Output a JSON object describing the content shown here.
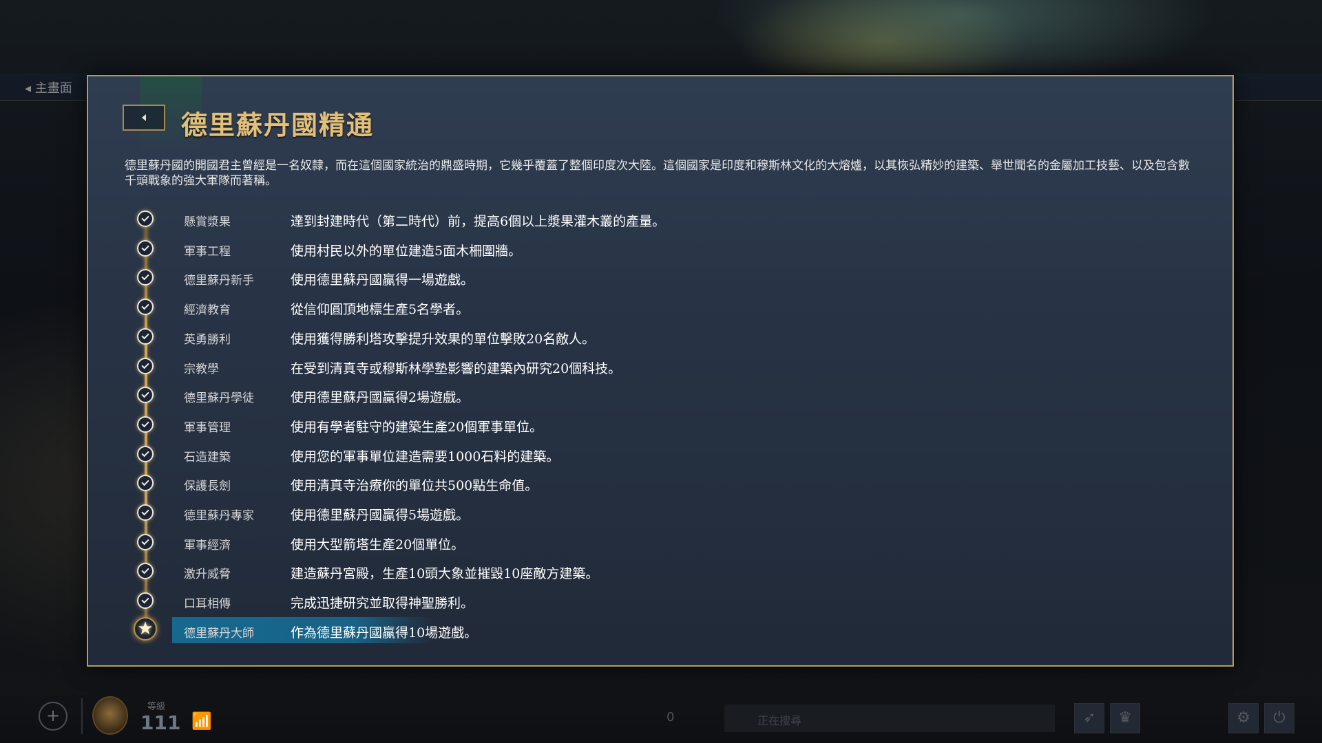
{
  "background": {
    "back_label": "◂ 主畫面"
  },
  "dialog": {
    "title": "德里蘇丹國精通",
    "description": "德里蘇丹國的開國君主曾經是一名奴隸，而在這個國家統治的鼎盛時期，它幾乎覆蓋了整個印度次大陸。這個國家是印度和穆斯林文化的大熔爐，以其恢弘精妙的建築、舉世聞名的金屬加工技藝、以及包含數千頭戰象的強大軍隊而著稱。",
    "back_icon": "chevron-left-icon",
    "accent_color": "#e3c07a",
    "highlight_color": "#166c94"
  },
  "masteries": [
    {
      "name": "懸賞漿果",
      "description": "達到封建時代（第二時代）前，提高6個以上漿果灌木叢的產量。",
      "status": "completed"
    },
    {
      "name": "軍事工程",
      "description": "使用村民以外的單位建造5面木柵圍牆。",
      "status": "completed"
    },
    {
      "name": "德里蘇丹新手",
      "description": "使用德里蘇丹國贏得一場遊戲。",
      "status": "completed"
    },
    {
      "name": "經濟教育",
      "description": "從信仰圓頂地標生產5名學者。",
      "status": "completed"
    },
    {
      "name": "英勇勝利",
      "description": "使用獲得勝利塔攻擊提升效果的單位擊敗20名敵人。",
      "status": "completed"
    },
    {
      "name": "宗教學",
      "description": "在受到清真寺或穆斯林學塾影響的建築內研究20個科技。",
      "status": "completed"
    },
    {
      "name": "德里蘇丹學徒",
      "description": "使用德里蘇丹國贏得2場遊戲。",
      "status": "completed"
    },
    {
      "name": "軍事管理",
      "description": "使用有學者駐守的建築生產20個軍事單位。",
      "status": "completed"
    },
    {
      "name": "石造建築",
      "description": "使用您的軍事單位建造需要1000石料的建築。",
      "status": "completed"
    },
    {
      "name": "保護長劍",
      "description": "使用清真寺治療你的單位共500點生命值。",
      "status": "completed"
    },
    {
      "name": "德里蘇丹專家",
      "description": "使用德里蘇丹國贏得5場遊戲。",
      "status": "completed"
    },
    {
      "name": "軍事經濟",
      "description": "使用大型箭塔生產20個單位。",
      "status": "completed"
    },
    {
      "name": "激升威脅",
      "description": "建造蘇丹宮殿，生產10頭大象並摧毀10座敵方建築。",
      "status": "completed"
    },
    {
      "name": "口耳相傳",
      "description": "完成迅捷研究並取得神聖勝利。",
      "status": "completed"
    },
    {
      "name": "德里蘇丹大師",
      "description": "作為德里蘇丹國贏得10場遊戲。",
      "status": "current"
    }
  ],
  "hud": {
    "add_icon": "plus-icon",
    "level_label": "等級",
    "level_value": "111",
    "wifi_icon": "wifi-icon",
    "player_count": "0",
    "queue_text": "正在搜尋",
    "buttons": [
      "arrow-icon",
      "crown-icon",
      "gear-icon",
      "power-icon"
    ]
  }
}
